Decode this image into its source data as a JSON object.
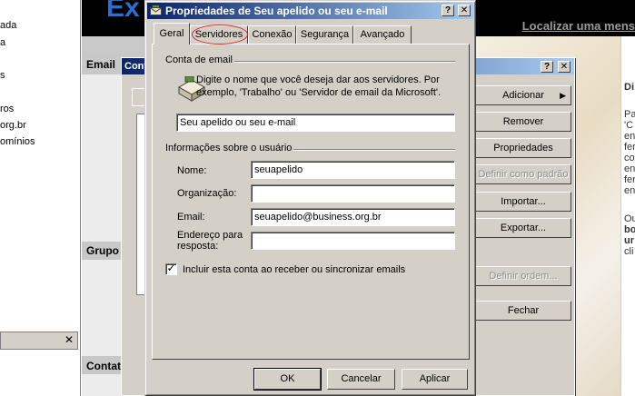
{
  "left_pane": {
    "items": [
      "ada",
      "a",
      "s",
      "",
      "ros",
      "org.br",
      "omínios"
    ],
    "contacts_close": "✕"
  },
  "app": {
    "brand": "Ex",
    "find_link": "Localizar uma mens",
    "sections": {
      "email": "Email",
      "groups": "Grupo",
      "contacts": "Contatos"
    }
  },
  "accounts_dialog": {
    "title": "Conta",
    "help": "?",
    "close": "✕",
    "buttons": {
      "add": "Adicionar",
      "remove": "Remover",
      "properties": "Propriedades",
      "set_default": "Definir como padrão",
      "import": "Importar...",
      "export": "Exportar...",
      "set_order": "Definir ordem...",
      "close": "Fechar"
    }
  },
  "right_panel": {
    "lines": [
      "Di",
      "Pa",
      "'C",
      "en",
      "fer",
      "co",
      "en",
      "fer",
      "en",
      "Ou",
      "bo",
      "ur",
      "cli"
    ]
  },
  "props_dialog": {
    "title": "Propriedades de Seu apelido ou seu e-mail",
    "help": "?",
    "close": "✕",
    "tabs": [
      "Geral",
      "Servidores",
      "Conexão",
      "Segurança",
      "Avançado"
    ],
    "account_group": "Conta de email",
    "description": "Digite o nome que você deseja dar aos servidores. Por exemplo, 'Trabalho' ou 'Servidor de email da Microsoft'.",
    "account_name": "Seu apelido ou seu e-mail",
    "user_group": "Informações sobre o usuário",
    "labels": {
      "name": "Nome:",
      "organization": "Organização:",
      "email": "Email:",
      "reply": "Endereço para resposta:"
    },
    "values": {
      "name": "seuapelido",
      "organization": "",
      "email": "seuapelido@business.org.br",
      "reply": ""
    },
    "include_label": "Incluir esta conta ao receber ou sincronizar emails",
    "include_checked": true,
    "buttons": {
      "ok": "OK",
      "cancel": "Cancelar",
      "apply": "Aplicar"
    }
  },
  "colors": {
    "titlebar_start": "#0a246a",
    "titlebar_end": "#a6caf0",
    "dialog_face": "#d4d0c8",
    "highlight_circle": "#e0202a",
    "brand": "#2a6fd6"
  }
}
